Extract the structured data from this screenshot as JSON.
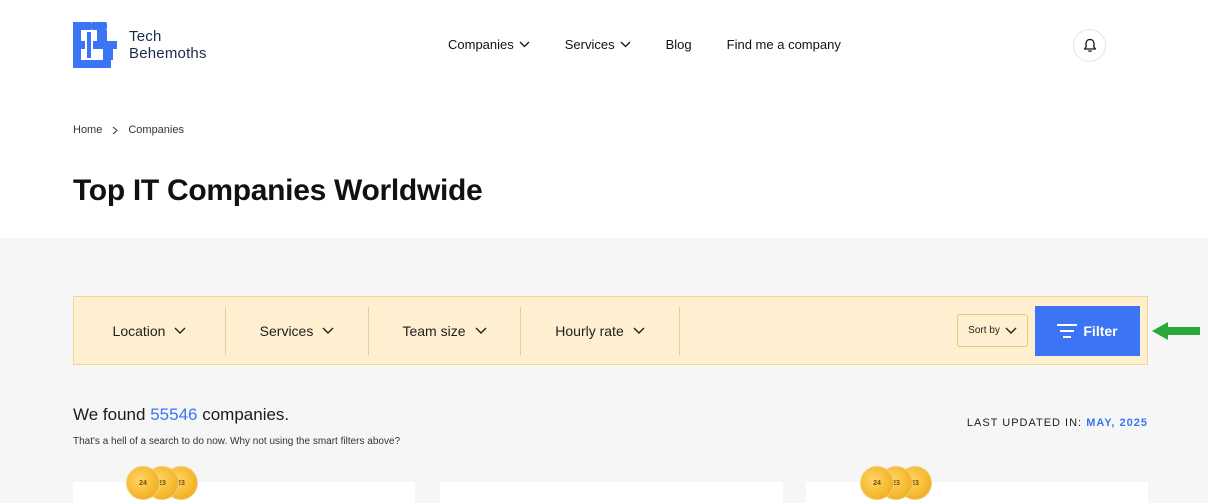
{
  "logo": {
    "line1": "Tech",
    "line2": "Behemoths",
    "brand_color": "#3b74f5"
  },
  "nav": {
    "items": [
      {
        "label": "Companies",
        "has_dropdown": true
      },
      {
        "label": "Services",
        "has_dropdown": true
      },
      {
        "label": "Blog",
        "has_dropdown": false
      },
      {
        "label": "Find me a company",
        "has_dropdown": false
      }
    ],
    "notification_icon": "bell-icon"
  },
  "breadcrumb": {
    "items": [
      "Home",
      "Companies"
    ]
  },
  "page": {
    "title": "Top IT Companies Worldwide"
  },
  "filters": {
    "items": [
      "Location",
      "Services",
      "Team size",
      "Hourly rate"
    ],
    "sort_label": "Sort by",
    "filter_button": "Filter",
    "bar_color": "#fdefcf",
    "button_color": "#3b74f5"
  },
  "results": {
    "prefix": "We found",
    "count": "55546",
    "suffix": "companies.",
    "subtext": "That's a hell of a search to do now. Why not using the smart filters above?",
    "updated_label": "LAST UPDATED IN:",
    "updated_date": "MAY, 2025"
  },
  "cards": {
    "badge_labels": [
      "24",
      "23",
      "23"
    ]
  },
  "annotation": {
    "arrow_color": "#2aa83a"
  }
}
